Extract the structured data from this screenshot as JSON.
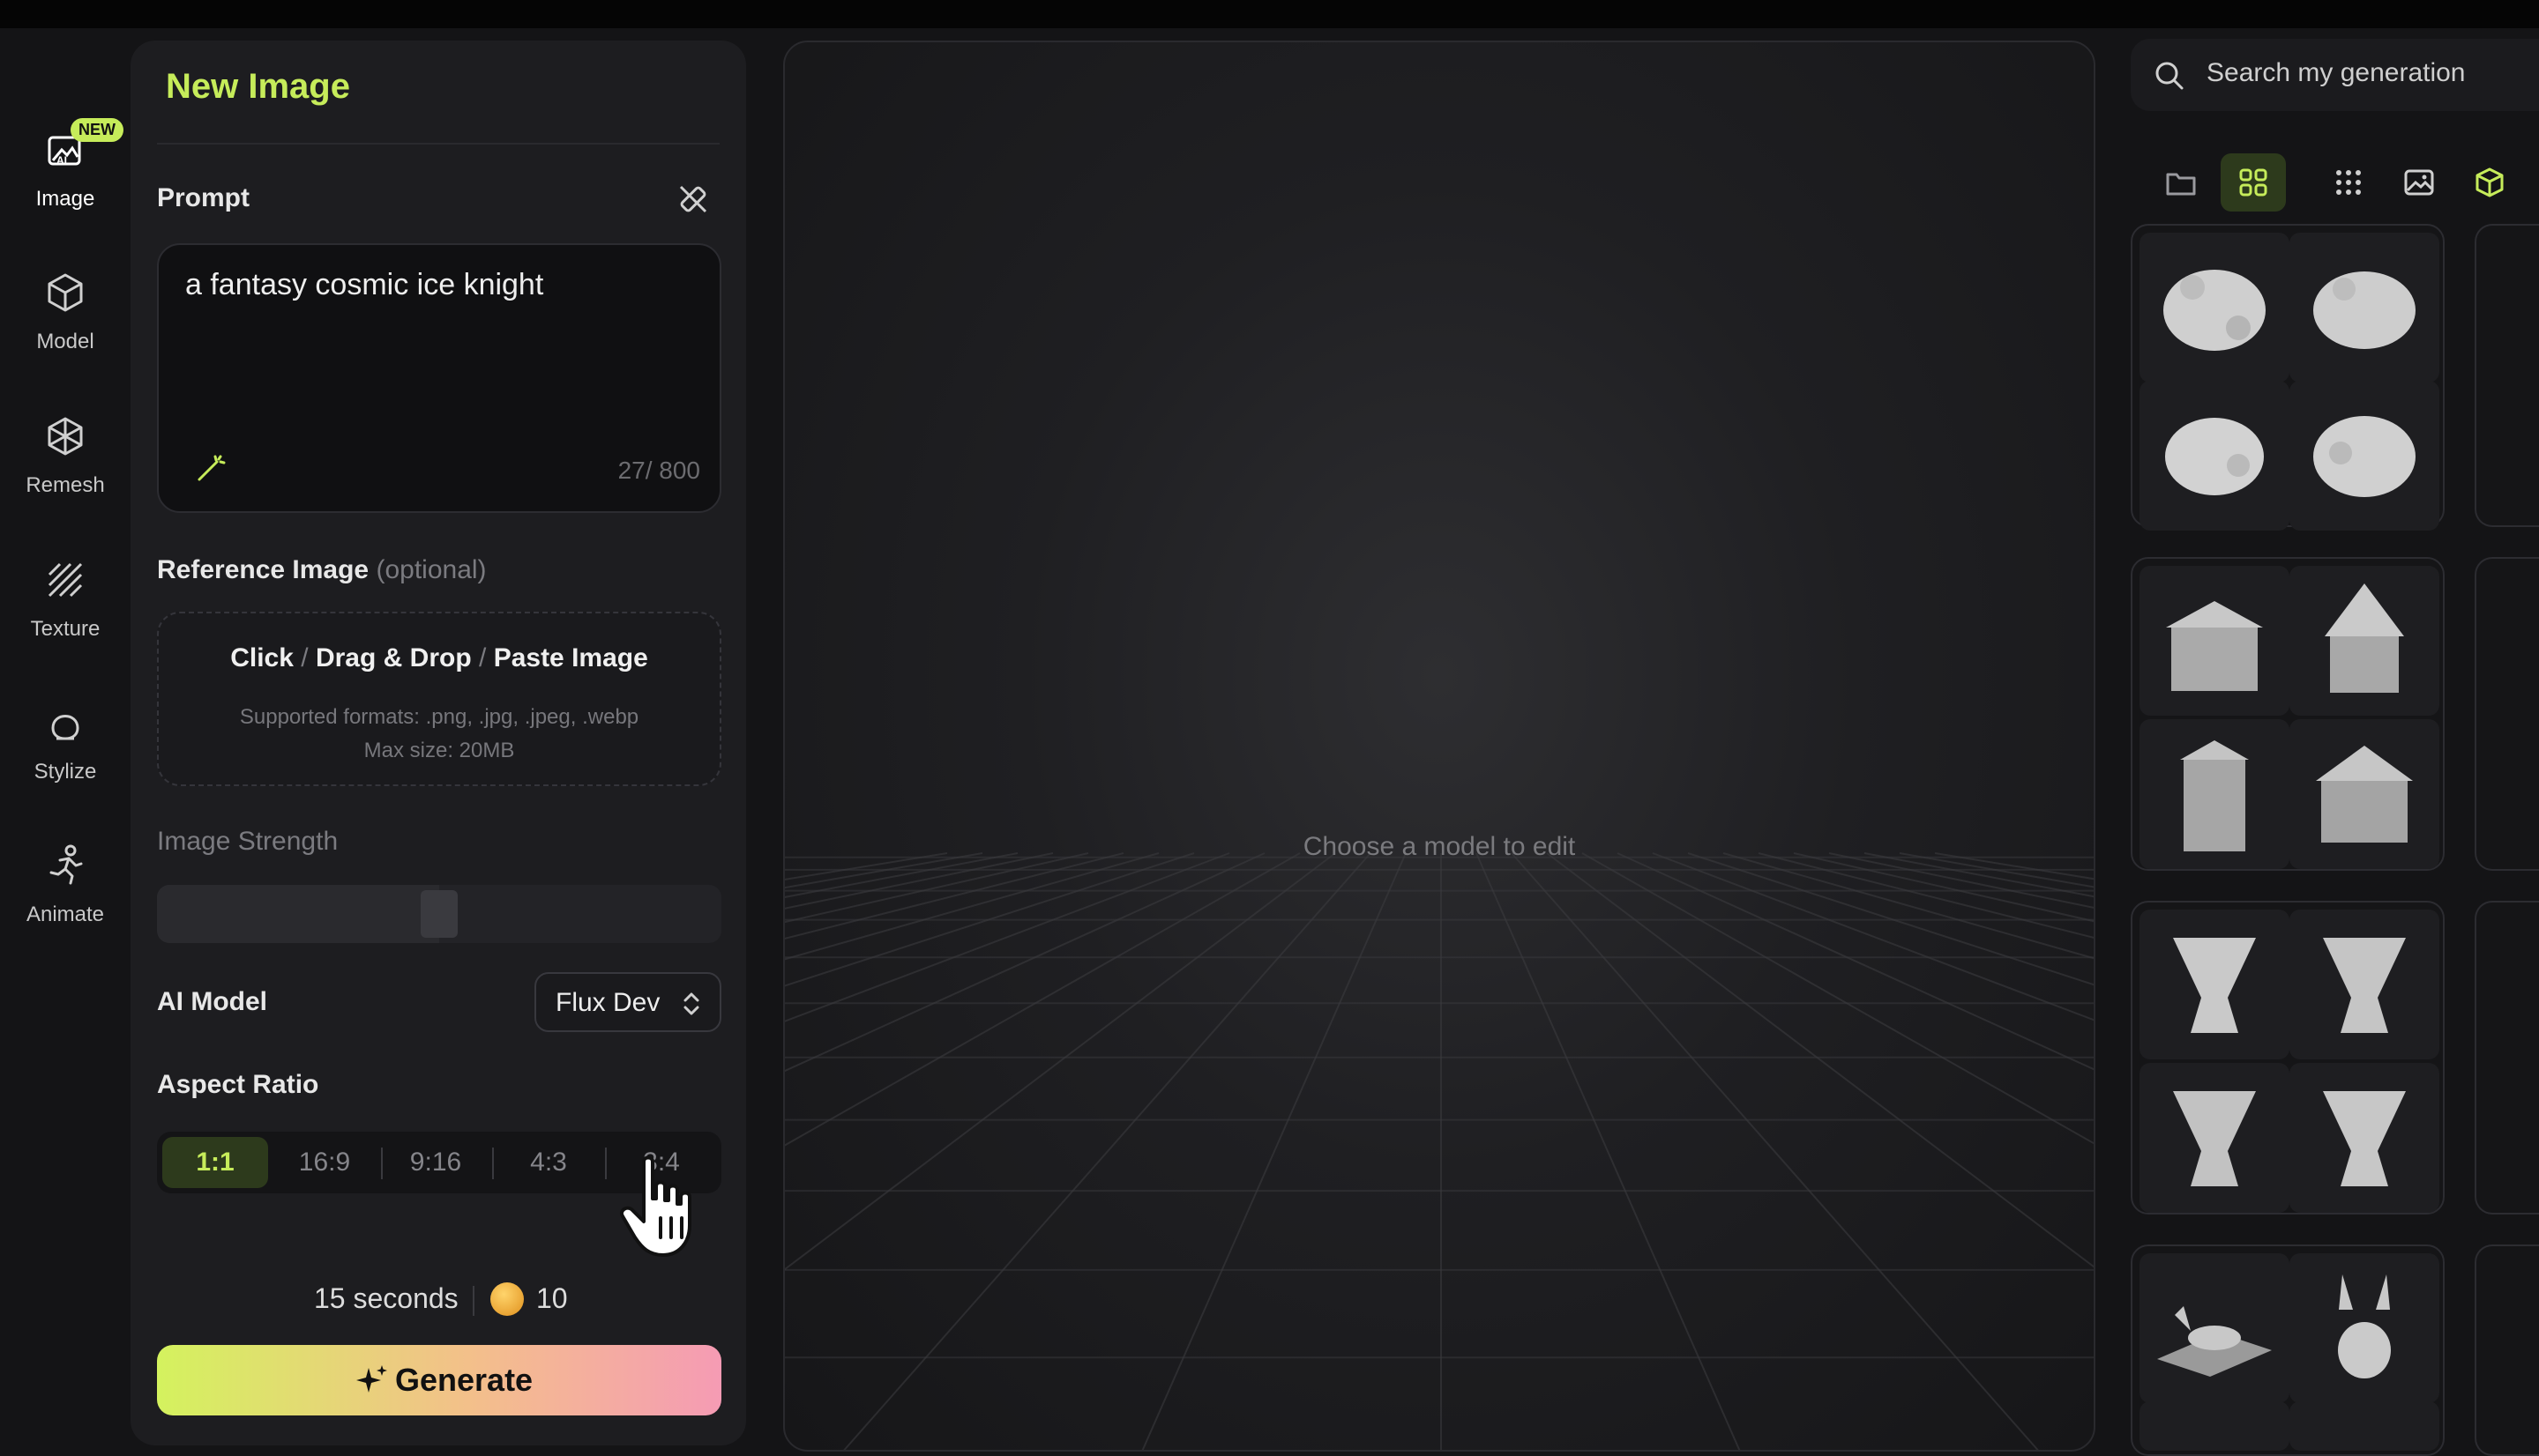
{
  "nav": {
    "new_badge": "NEW",
    "items": [
      {
        "label": "Image",
        "icon": "image-ai-icon"
      },
      {
        "label": "Model",
        "icon": "cube-icon"
      },
      {
        "label": "Remesh",
        "icon": "remesh-icon"
      },
      {
        "label": "Texture",
        "icon": "texture-icon"
      },
      {
        "label": "Stylize",
        "icon": "stylize-icon"
      },
      {
        "label": "Animate",
        "icon": "running-figure-icon"
      }
    ]
  },
  "panel": {
    "title": "New Image",
    "prompt_label": "Prompt",
    "prompt_value": "a fantasy cosmic ice knight",
    "prompt_counter": "27/ 800",
    "reference_label": "Reference Image",
    "reference_optional": "(optional)",
    "reference_actions": [
      "Click",
      "Drag & Drop",
      "Paste Image"
    ],
    "reference_formats": "Supported formats: .png, .jpg, .jpeg, .webp",
    "reference_max": "Max size: 20MB",
    "strength_label": "Image Strength",
    "strength_value": 0.5,
    "model_label": "AI Model",
    "model_value": "Flux Dev",
    "aspect_label": "Aspect Ratio",
    "aspect_options": [
      "1:1",
      "16:9",
      "9:16",
      "4:3",
      "3:4"
    ],
    "aspect_selected": "1:1",
    "time_estimate": "15 seconds",
    "credit_cost": "10",
    "generate_label": "Generate"
  },
  "viewport": {
    "message": "Choose a model to edit"
  },
  "gallery": {
    "search_placeholder": "Search my generation",
    "filters": [
      "folder-icon",
      "grid-large-icon",
      "grid-small-icon",
      "image-icon",
      "cube-icon"
    ],
    "active_filter": "grid-large-icon",
    "groups": [
      "piggy-bank",
      "house",
      "vase",
      "dog"
    ]
  },
  "colors": {
    "accent": "#c6ec5a",
    "panel_bg": "#1d1d20",
    "page_bg": "#141416"
  }
}
